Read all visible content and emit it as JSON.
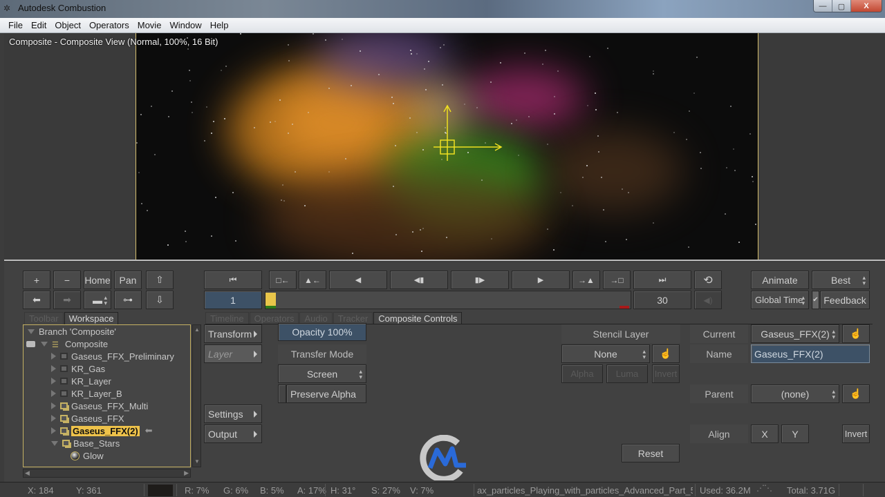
{
  "window": {
    "title": "Autodesk Combustion",
    "minimize": "—",
    "maximize": "▢",
    "close": "X"
  },
  "menu": [
    "File",
    "Edit",
    "Object",
    "Operators",
    "Movie",
    "Window",
    "Help"
  ],
  "viewer": {
    "label": "Composite - Composite View (Normal, 100%, 16 Bit)"
  },
  "nav_buttons": {
    "zoom_in": "+",
    "zoom_out": "−",
    "home": "Home",
    "pan": "Pan",
    "up": "⇧",
    "back": "⬅",
    "forward": "➡",
    "view_select": "▬",
    "schematic": "⊶",
    "down": "⇩"
  },
  "transport": {
    "go_start": "⏮",
    "prev_key_in": "□←",
    "prev_key": "▲←",
    "play_back": "◀",
    "step_back": "◀▮",
    "step_fwd": "▮▶",
    "play": "▶",
    "next_key": "→▲",
    "next_key_out": "→□",
    "go_end": "⏭",
    "loop": "⟲",
    "current_frame": "1",
    "end_frame": "30",
    "audio": "◀)",
    "timeline_position": 0.0
  },
  "right_top": {
    "animate": "Animate",
    "quality": "Best",
    "time_mode": "Global Time",
    "feedback_checked": true,
    "feedback": "Feedback"
  },
  "left_tabs": [
    {
      "label": "Toolbar",
      "active": false
    },
    {
      "label": "Workspace",
      "active": true
    }
  ],
  "main_tabs": [
    {
      "label": "Timeline",
      "active": false
    },
    {
      "label": "Operators",
      "active": false
    },
    {
      "label": "Audio",
      "active": false
    },
    {
      "label": "Tracker",
      "active": false
    },
    {
      "label": "Composite Controls",
      "active": true
    }
  ],
  "tree": {
    "branch": "Branch 'Composite'",
    "root": "Composite",
    "items": [
      {
        "label": "Gaseus_FFX_Preliminary",
        "type": "small"
      },
      {
        "label": "KR_Gas",
        "type": "small"
      },
      {
        "label": "KR_Layer",
        "type": "small"
      },
      {
        "label": "KR_Layer_B",
        "type": "small"
      },
      {
        "label": "Gaseus_FFX_Multi",
        "type": "layer"
      },
      {
        "label": "Gaseus_FFX",
        "type": "layer"
      },
      {
        "label": "Gaseus_FFX(2)",
        "type": "layer",
        "selected": true
      },
      {
        "label": "Base_Stars",
        "type": "layer",
        "expanded": true
      }
    ],
    "child": "Glow"
  },
  "categories": {
    "transform": "Transform",
    "layer": "Layer",
    "settings": "Settings",
    "output": "Output"
  },
  "layer_controls": {
    "opacity": "Opacity 100%",
    "transfer_mode_label": "Transfer Mode",
    "transfer_mode": "Screen",
    "preserve_alpha": "Preserve Alpha",
    "stencil_label": "Stencil Layer",
    "stencil_value": "None",
    "alpha": "Alpha",
    "luma": "Luma",
    "invert": "Invert",
    "reset": "Reset",
    "current_label": "Current",
    "current_value": "Gaseus_FFX(2)",
    "name_label": "Name",
    "name_value": "Gaseus_FFX(2)",
    "parent_label": "Parent",
    "parent_value": "(none)",
    "align_label": "Align",
    "align_x": "X",
    "align_y": "Y",
    "align_invert": "Invert",
    "pick_icon": "☝"
  },
  "status": {
    "x": "X:   184",
    "y": "Y:  361",
    "r": "R: 7%",
    "g": "G: 6%",
    "b": "B: 5%",
    "a": "A: 17%",
    "h": "H: 31°",
    "s": "S: 27%",
    "v": "V: 7%",
    "file": "ax_particles_Playing_with_particles_Advanced_Part_5",
    "used": "Used: 36.2M",
    "total": "Total: 3.71G"
  }
}
